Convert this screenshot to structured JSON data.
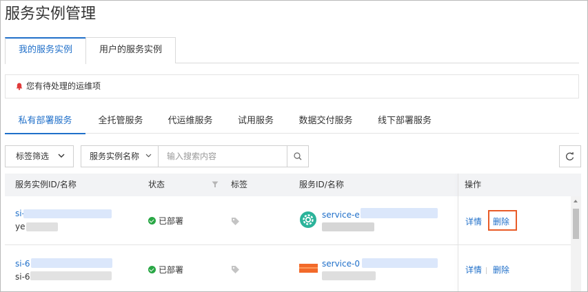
{
  "page": {
    "title": "服务实例管理"
  },
  "top_tabs": [
    {
      "label": "我的服务实例",
      "active": true
    },
    {
      "label": "用户的服务实例",
      "active": false
    }
  ],
  "alert": {
    "text": "您有待处理的运维项",
    "icon": "bell-icon",
    "icon_color": "#e03a3a"
  },
  "sub_tabs": [
    {
      "label": "私有部署服务",
      "active": true
    },
    {
      "label": "全托管服务",
      "active": false
    },
    {
      "label": "代运维服务",
      "active": false
    },
    {
      "label": "试用服务",
      "active": false
    },
    {
      "label": "数据交付服务",
      "active": false
    },
    {
      "label": "线下部署服务",
      "active": false
    }
  ],
  "toolbar": {
    "tag_filter_label": "标签筛选",
    "search_field_label": "服务实例名称",
    "search_placeholder": "输入搜索内容",
    "search_icon": "search-icon",
    "refresh_icon": "refresh-icon"
  },
  "table": {
    "columns": [
      "服务实例ID/名称",
      "状态",
      "标签",
      "服务ID/名称",
      "操作"
    ],
    "rows": [
      {
        "id_prefix": "si-",
        "name_prefix": "ye",
        "status": "已部署",
        "service_id_prefix": "service-e",
        "actions": {
          "detail": "详情",
          "delete": "删除"
        }
      },
      {
        "id_prefix": "si-6",
        "name_prefix": "si-6",
        "status": "已部署",
        "service_id_prefix": "service-0",
        "actions": {
          "detail": "详情",
          "delete": "删除"
        }
      }
    ]
  },
  "colors": {
    "accent": "#1f6fc9",
    "success": "#29a745",
    "highlight": "#e85a26"
  }
}
